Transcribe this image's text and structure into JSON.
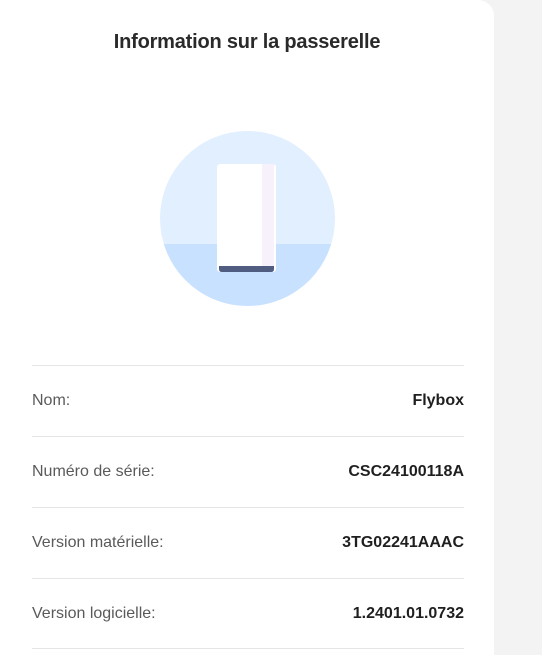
{
  "panel": {
    "title": "Information sur la passerelle",
    "illustration_icon": "gateway-device-icon"
  },
  "info_rows": [
    {
      "label": "Nom:",
      "value": "Flybox"
    },
    {
      "label": "Numéro de série:",
      "value": "CSC24100118A"
    },
    {
      "label": "Version matérielle:",
      "value": "3TG02241AAAC"
    },
    {
      "label": "Version logicielle:",
      "value": "1.2401.01.0732"
    }
  ],
  "colors": {
    "background": "#f3f3f3",
    "card": "#ffffff",
    "illustration_top": "#e1efff",
    "illustration_bottom": "#c7e1ff",
    "device_body": "#ffffff",
    "device_base": "#515d80"
  }
}
